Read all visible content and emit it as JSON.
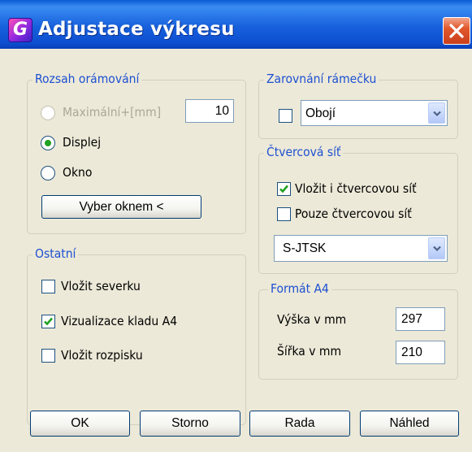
{
  "window": {
    "title": "Adjustace výkresu",
    "app_icon": "G-logo"
  },
  "rozsah": {
    "legend": "Rozsah orámování",
    "maximalni_label": "Maximální+[mm]",
    "maximalni_value": "10",
    "displej_label": "Displej",
    "okno_label": "Okno",
    "vyber_button": "Vyber oknem <"
  },
  "ostatni": {
    "legend": "Ostatní",
    "severka_label": "Vložit severku",
    "vizualizace_label": "Vizualizace kladu A4",
    "rozpisku_label": "Vložit rozpisku"
  },
  "zarovnani": {
    "legend": "Zarovnání rámečku",
    "combo_value": "Obojí"
  },
  "sit": {
    "legend": "Čtvercová síť",
    "vlozit_label": "Vložit i čtvercovou síť",
    "pouze_label": "Pouze čtvercovou síť",
    "combo_value": "S-JTSK"
  },
  "format": {
    "legend": "Formát A4",
    "vyska_label": "Výška v mm",
    "vyska_value": "297",
    "sirka_label": "Šířka v mm",
    "sirka_value": "210"
  },
  "buttons": {
    "ok": "OK",
    "storno": "Storno",
    "rada": "Rada",
    "nahled": "Náhled"
  },
  "state": {
    "maximalni_selected": false,
    "displej_selected": true,
    "okno_selected": false,
    "zarovnani_checked": false,
    "severka_checked": false,
    "vizualizace_checked": true,
    "rozpisku_checked": false,
    "vlozit_sit_checked": true,
    "pouze_sit_checked": false
  },
  "colors": {
    "titlebar": "#0a5ad4",
    "dialog_bg": "#ece9d8",
    "groupbox_title": "#1e50d2",
    "check_green": "#21a121",
    "close_red": "#e2582d"
  }
}
